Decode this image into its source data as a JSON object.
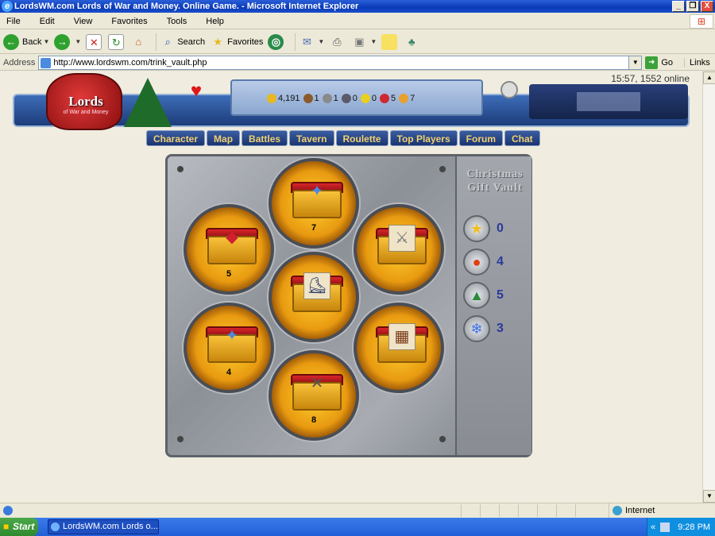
{
  "window": {
    "title": "LordsWM.com Lords of War and Money. Online Game. - Microsoft Internet Explorer",
    "buttons": [
      "_",
      "❐",
      "X"
    ]
  },
  "menu": [
    "File",
    "Edit",
    "View",
    "Favorites",
    "Tools",
    "Help"
  ],
  "toolbar": {
    "back": "Back",
    "search": "Search",
    "favorites": "Favorites"
  },
  "address": {
    "label": "Address",
    "url": "http://www.lordswm.com/trink_vault.php",
    "go": "Go",
    "links": "Links"
  },
  "game": {
    "logo": "Lords",
    "logo_sub": "of War and Money",
    "status_time": "15:57, 1552 online",
    "resources": [
      {
        "name": "gold",
        "value": "4,191",
        "color": "#e8b820"
      },
      {
        "name": "wood",
        "value": "1",
        "color": "#8a5a2a"
      },
      {
        "name": "ore",
        "value": "1",
        "color": "#8a8a8a"
      },
      {
        "name": "mercury",
        "value": "0",
        "color": "#5a5a6a"
      },
      {
        "name": "sulfur",
        "value": "0",
        "color": "#e8d020"
      },
      {
        "name": "crystals",
        "value": "5",
        "color": "#d02830"
      },
      {
        "name": "gems",
        "value": "7",
        "color": "#e8a030"
      }
    ],
    "nav": [
      "Character",
      "Map",
      "Battles",
      "Tavern",
      "Roulette",
      "Top Players",
      "Forum",
      "Chat"
    ],
    "vault_title": "Christmas Gift Vault",
    "chests": [
      {
        "item": "gems",
        "icon": "✦",
        "count": "7"
      },
      {
        "item": "crystal",
        "icon": "◆",
        "count": "5"
      },
      {
        "item": "sword",
        "icon": "⚔",
        "count": ""
      },
      {
        "item": "boots",
        "icon": "⛸",
        "count": ""
      },
      {
        "item": "gems",
        "icon": "✦",
        "count": "4"
      },
      {
        "item": "vest",
        "icon": "▦",
        "count": ""
      },
      {
        "item": "crossed-swords",
        "icon": "✕",
        "count": "8"
      }
    ],
    "prizes": [
      {
        "name": "star",
        "icon": "★",
        "value": "0",
        "color": "#f0c020"
      },
      {
        "name": "lantern",
        "icon": "●",
        "value": "4",
        "color": "#e04010"
      },
      {
        "name": "tree",
        "icon": "▲",
        "value": "5",
        "color": "#2a8a3a"
      },
      {
        "name": "snowflake",
        "icon": "❄",
        "value": "3",
        "color": "#3a6ae0"
      }
    ]
  },
  "statusbar": {
    "zone": "Internet"
  },
  "taskbar": {
    "start": "Start",
    "task": "LordsWM.com Lords o...",
    "time": "9:28 PM"
  }
}
